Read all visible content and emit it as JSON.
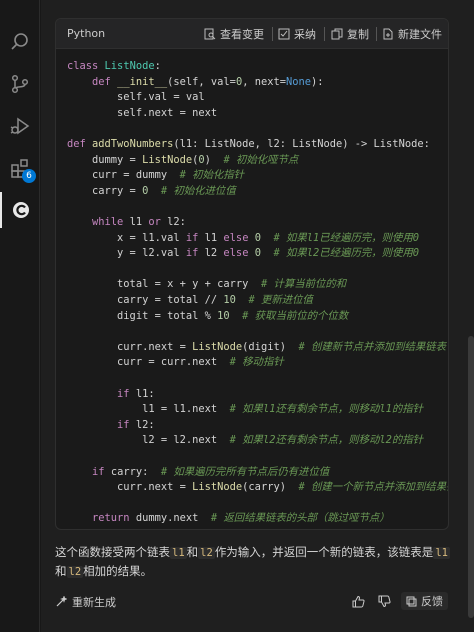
{
  "activity_bar": {
    "items": [
      {
        "icon": "search-icon"
      },
      {
        "icon": "source-control-icon"
      },
      {
        "icon": "run-debug-icon"
      },
      {
        "icon": "extensions-icon",
        "badge": "6"
      },
      {
        "icon": "ai-assistant-icon"
      }
    ]
  },
  "code_block": {
    "language": "Python",
    "actions": {
      "view_changes": "查看变更",
      "accept": "采纳",
      "copy": "复制",
      "new_file": "新建文件"
    },
    "lines": [
      [
        [
          "kw",
          "class "
        ],
        [
          "ty",
          "ListNode"
        ],
        [
          "id",
          ":"
        ]
      ],
      [
        [
          "id",
          "    "
        ],
        [
          "kw",
          "def "
        ],
        [
          "fn",
          "__init__"
        ],
        [
          "id",
          "(self, val="
        ],
        [
          "num",
          "0"
        ],
        [
          "id",
          ", next="
        ],
        [
          "bl",
          "None"
        ],
        [
          "id",
          "):"
        ]
      ],
      [
        [
          "id",
          "        self.val = val"
        ]
      ],
      [
        [
          "id",
          "        self.next = next"
        ]
      ],
      [],
      [
        [
          "kw",
          "def "
        ],
        [
          "fn",
          "addTwoNumbers"
        ],
        [
          "id",
          "(l1: ListNode, l2: ListNode) -> ListNode:"
        ]
      ],
      [
        [
          "id",
          "    dummy = "
        ],
        [
          "fn",
          "ListNode"
        ],
        [
          "id",
          "("
        ],
        [
          "num",
          "0"
        ],
        [
          "id",
          ")  "
        ],
        [
          "cm",
          "# 初始化哑节点"
        ]
      ],
      [
        [
          "id",
          "    curr = dummy  "
        ],
        [
          "cm",
          "# 初始化指针"
        ]
      ],
      [
        [
          "id",
          "    carry = "
        ],
        [
          "num",
          "0"
        ],
        [
          "id",
          "  "
        ],
        [
          "cm",
          "# 初始化进位值"
        ]
      ],
      [],
      [
        [
          "id",
          "    "
        ],
        [
          "kw",
          "while "
        ],
        [
          "id",
          "l1 "
        ],
        [
          "kw",
          "or "
        ],
        [
          "id",
          "l2:"
        ]
      ],
      [
        [
          "id",
          "        x = l1.val "
        ],
        [
          "kw",
          "if "
        ],
        [
          "id",
          "l1 "
        ],
        [
          "kw",
          "else "
        ],
        [
          "num",
          "0"
        ],
        [
          "id",
          "  "
        ],
        [
          "cm",
          "# 如果l1已经遍历完，则使用0"
        ]
      ],
      [
        [
          "id",
          "        y = l2.val "
        ],
        [
          "kw",
          "if "
        ],
        [
          "id",
          "l2 "
        ],
        [
          "kw",
          "else "
        ],
        [
          "num",
          "0"
        ],
        [
          "id",
          "  "
        ],
        [
          "cm",
          "# 如果l2已经遍历完，则使用0"
        ]
      ],
      [],
      [
        [
          "id",
          "        total = x + y + carry  "
        ],
        [
          "cm",
          "# 计算当前位的和"
        ]
      ],
      [
        [
          "id",
          "        carry = total // "
        ],
        [
          "num",
          "10"
        ],
        [
          "id",
          "  "
        ],
        [
          "cm",
          "# 更新进位值"
        ]
      ],
      [
        [
          "id",
          "        digit = total % "
        ],
        [
          "num",
          "10"
        ],
        [
          "id",
          "  "
        ],
        [
          "cm",
          "# 获取当前位的个位数"
        ]
      ],
      [],
      [
        [
          "id",
          "        curr.next = "
        ],
        [
          "fn",
          "ListNode"
        ],
        [
          "id",
          "(digit)  "
        ],
        [
          "cm",
          "# 创建新节点并添加到结果链表"
        ]
      ],
      [
        [
          "id",
          "        curr = curr.next  "
        ],
        [
          "cm",
          "# 移动指针"
        ]
      ],
      [],
      [
        [
          "id",
          "        "
        ],
        [
          "kw",
          "if "
        ],
        [
          "id",
          "l1:"
        ]
      ],
      [
        [
          "id",
          "            l1 = l1.next  "
        ],
        [
          "cm",
          "# 如果l1还有剩余节点，则移动l1的指针"
        ]
      ],
      [
        [
          "id",
          "        "
        ],
        [
          "kw",
          "if "
        ],
        [
          "id",
          "l2:"
        ]
      ],
      [
        [
          "id",
          "            l2 = l2.next  "
        ],
        [
          "cm",
          "# 如果l2还有剩余节点，则移动l2的指针"
        ]
      ],
      [],
      [
        [
          "id",
          "    "
        ],
        [
          "kw",
          "if "
        ],
        [
          "id",
          "carry:  "
        ],
        [
          "cm",
          "# 如果遍历完所有节点后仍有进位值"
        ]
      ],
      [
        [
          "id",
          "        curr.next = "
        ],
        [
          "fn",
          "ListNode"
        ],
        [
          "id",
          "(carry)  "
        ],
        [
          "cm",
          "# 创建一个新节点并添加到结果链表"
        ]
      ],
      [],
      [
        [
          "id",
          "    "
        ],
        [
          "kw",
          "return "
        ],
        [
          "id",
          "dummy.next  "
        ],
        [
          "cm",
          "# 返回结果链表的头部（跳过哑节点）"
        ]
      ]
    ]
  },
  "explanation": {
    "part1": "这个函数接受两个链表",
    "code1": "l1",
    "part2": "和",
    "code2": "l2",
    "part3": "作为输入，并返回一个新的链表，该链表是",
    "code3": "l1",
    "part4": "和",
    "code4": "l2",
    "part5": "相加的结果。"
  },
  "footer": {
    "regenerate": "重新生成",
    "feedback": "反馈"
  },
  "colors": {
    "keyword": "#c586c0",
    "function": "#dcdcaa",
    "comment": "#6a9955",
    "number": "#b5cea8",
    "badge": "#0078d4"
  }
}
